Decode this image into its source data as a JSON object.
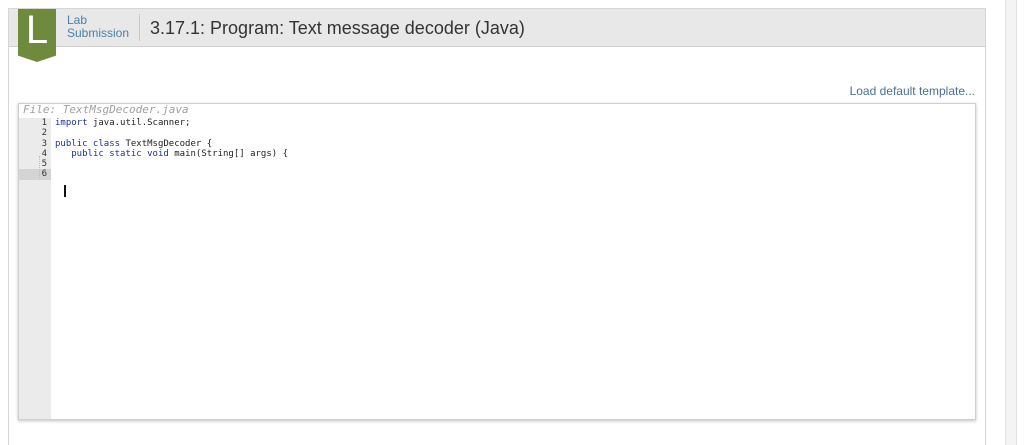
{
  "header": {
    "badge_letter": "L",
    "lab_type_line1": "Lab",
    "lab_type_line2": "Submission",
    "title": "3.17.1: Program: Text message decoder (Java)"
  },
  "actions": {
    "load_template": "Load default template..."
  },
  "editor": {
    "filename": "File: TextMsgDecoder.java",
    "line_numbers": [
      "1",
      "2",
      "3",
      "4",
      "5",
      "6"
    ],
    "active_line": 6,
    "lines": {
      "l1_kw": "import",
      "l1_rest": " java.util.Scanner;",
      "l3_kw1": "public",
      "l3_kw2": " class",
      "l3_rest": " TextMsgDecoder {",
      "l4_indent": "   ",
      "l4_kw1": "public",
      "l4_kw2": " static",
      "l4_kw3": " void",
      "l4_rest": " main(String[] args) {"
    }
  },
  "colors": {
    "badge": "#6e8b3d",
    "keyword": "#1e2fa8",
    "link": "#4a6f9a"
  }
}
